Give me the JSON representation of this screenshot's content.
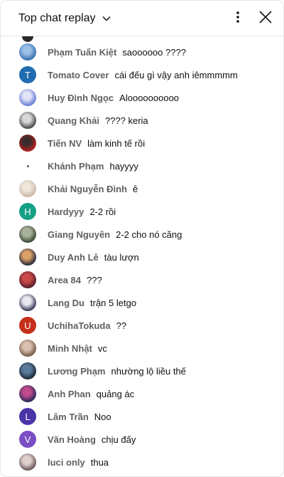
{
  "header": {
    "title": "Top chat replay",
    "title_icon": "chevron-down-icon",
    "more_icon": "more-vert-icon",
    "close_icon": "close-icon"
  },
  "messages": [
    {
      "author": "Phạm Tuấn Kiệt",
      "text": "saoooooo ????",
      "avatar": {
        "kind": "photo",
        "colors": [
          "#3a6fb0",
          "#9cc0e6"
        ]
      }
    },
    {
      "author": "Tomato Cover",
      "text": "cái đếu gì vậy anh iêmmmmm",
      "avatar": {
        "kind": "letter",
        "letter": "T",
        "color": "#1f6cb0"
      }
    },
    {
      "author": "Huy Đình Ngọc",
      "text": "Aloooooooooo",
      "avatar": {
        "kind": "photo",
        "colors": [
          "#6b7fd6",
          "#e0e4f6"
        ]
      }
    },
    {
      "author": "Quang Khải",
      "text": "???? keria",
      "avatar": {
        "kind": "photo",
        "colors": [
          "#4a4a4a",
          "#d8d8d8"
        ]
      }
    },
    {
      "author": "Tiến NV",
      "text": "làm kinh tế rồi",
      "avatar": {
        "kind": "photo",
        "colors": [
          "#b22222",
          "#3b2a2a"
        ]
      }
    },
    {
      "author": "Khánh Phạm",
      "text": "hayyyy",
      "avatar": {
        "kind": "blank"
      }
    },
    {
      "author": "Khải Nguyễn Đình",
      "text": "ê",
      "avatar": {
        "kind": "photo",
        "colors": [
          "#c9b8a8",
          "#efe6dc"
        ]
      }
    },
    {
      "author": "Hardyyy",
      "text": "2-2 rồi",
      "avatar": {
        "kind": "letter",
        "letter": "H",
        "color": "#14a085"
      }
    },
    {
      "author": "Giang Nguyên",
      "text": "2-2 cho nó căng",
      "avatar": {
        "kind": "photo",
        "colors": [
          "#3f4a3a",
          "#a9b39c"
        ]
      }
    },
    {
      "author": "Duy Anh Lê",
      "text": "tàu lượn",
      "avatar": {
        "kind": "photo",
        "colors": [
          "#2b2b40",
          "#d9a066"
        ]
      }
    },
    {
      "author": "Area 84",
      "text": "???",
      "avatar": {
        "kind": "photo",
        "colors": [
          "#5a1f2a",
          "#c94a4a"
        ]
      }
    },
    {
      "author": "Lang Du",
      "text": "trận 5 letgo",
      "avatar": {
        "kind": "photo",
        "colors": [
          "#3c3c5a",
          "#e8e8ee"
        ]
      }
    },
    {
      "author": "UchihaTokuda",
      "text": "??",
      "avatar": {
        "kind": "letter",
        "letter": "U",
        "color": "#c4301a"
      }
    },
    {
      "author": "Minh Nhật",
      "text": "vc",
      "avatar": {
        "kind": "photo",
        "colors": [
          "#7a5a4a",
          "#d8c0b0"
        ]
      }
    },
    {
      "author": "Lương Phạm",
      "text": "nhường lộ liều thế",
      "avatar": {
        "kind": "photo",
        "colors": [
          "#1f2a3a",
          "#5a7a9a"
        ]
      }
    },
    {
      "author": "Anh Phan",
      "text": "quảng ác",
      "avatar": {
        "kind": "photo",
        "colors": [
          "#2a2a5a",
          "#c04a8a"
        ]
      }
    },
    {
      "author": "Lâm Trần",
      "text": "Noo",
      "avatar": {
        "kind": "letter",
        "letter": "L",
        "color": "#4a34a8"
      }
    },
    {
      "author": "Văn Hoàng",
      "text": "chịu đấy",
      "avatar": {
        "kind": "letter",
        "letter": "V",
        "color": "#7a4ec4"
      }
    },
    {
      "author": "luci only",
      "text": "thua",
      "avatar": {
        "kind": "photo",
        "colors": [
          "#6a5a5a",
          "#e0d0d0"
        ]
      }
    }
  ]
}
